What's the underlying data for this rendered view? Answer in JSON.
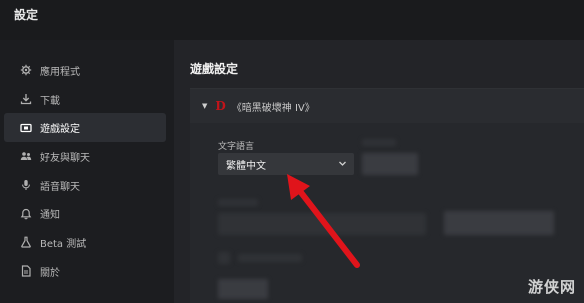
{
  "window": {
    "title": "設定"
  },
  "sidebar": {
    "items": [
      {
        "label": "應用程式",
        "icon": "gear-icon"
      },
      {
        "label": "下載",
        "icon": "download-icon"
      },
      {
        "label": "遊戲設定",
        "icon": "game-icon",
        "active": true
      },
      {
        "label": "好友與聊天",
        "icon": "friends-icon"
      },
      {
        "label": "語音聊天",
        "icon": "microphone-icon"
      },
      {
        "label": "通知",
        "icon": "bell-icon"
      },
      {
        "label": "Beta 測試",
        "icon": "flask-icon"
      },
      {
        "label": "關於",
        "icon": "document-icon"
      }
    ]
  },
  "main": {
    "section_title": "遊戲設定",
    "game": {
      "logo": "D",
      "name": "《暗黑破壞神 IV》",
      "expanded": true
    },
    "text_language": {
      "label": "文字語言",
      "value": "繁體中文"
    }
  },
  "annotation": {
    "arrow_color": "#e0141b"
  },
  "watermark": {
    "text": "游侠网"
  },
  "colors": {
    "accent_red": "#c1141a",
    "active_bg": "#2c2e33"
  }
}
